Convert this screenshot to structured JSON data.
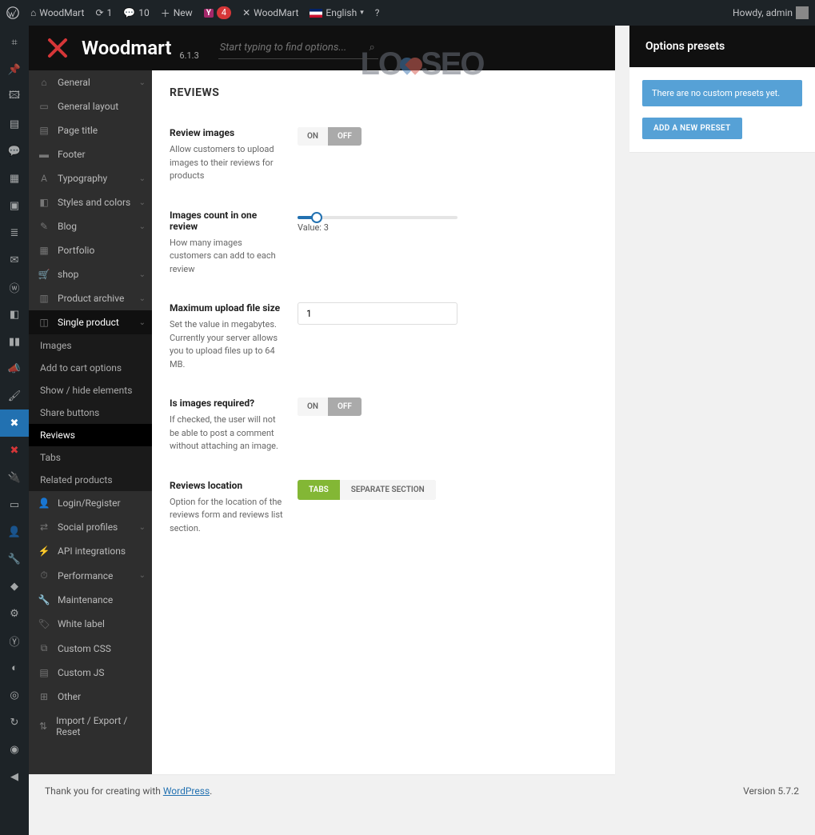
{
  "wp_bar": {
    "site": "WoodMart",
    "updates": "1",
    "comments": "10",
    "new": "New",
    "yoast_badge": "4",
    "theme_link": "WoodMart",
    "lang": "English",
    "howdy": "Howdy, admin"
  },
  "header": {
    "brand": "Woodmart",
    "version": "6.1.3",
    "search_placeholder": "Start typing to find options..."
  },
  "nav": {
    "items": [
      {
        "label": "General",
        "icon": "home",
        "chev": true
      },
      {
        "label": "General layout",
        "icon": "layout"
      },
      {
        "label": "Page title",
        "icon": "title"
      },
      {
        "label": "Footer",
        "icon": "footer"
      },
      {
        "label": "Typography",
        "icon": "type",
        "chev": true
      },
      {
        "label": "Styles and colors",
        "icon": "palette",
        "chev": true
      },
      {
        "label": "Blog",
        "icon": "blog",
        "chev": true
      },
      {
        "label": "Portfolio",
        "icon": "grid"
      },
      {
        "label": "shop",
        "icon": "cart",
        "chev": true
      },
      {
        "label": "Product archive",
        "icon": "archive",
        "chev": true
      },
      {
        "label": "Single product",
        "icon": "product",
        "chev": true,
        "active": true
      },
      {
        "label": "Login/Register",
        "icon": "user"
      },
      {
        "label": "Social profiles",
        "icon": "share",
        "chev": true
      },
      {
        "label": "API integrations",
        "icon": "api"
      },
      {
        "label": "Performance",
        "icon": "perf",
        "chev": true
      },
      {
        "label": "Maintenance",
        "icon": "wrench"
      },
      {
        "label": "White label",
        "icon": "tag"
      },
      {
        "label": "Custom CSS",
        "icon": "css"
      },
      {
        "label": "Custom JS",
        "icon": "js"
      },
      {
        "label": "Other",
        "icon": "other"
      },
      {
        "label": "Import / Export / Reset",
        "icon": "import"
      }
    ],
    "sub": [
      {
        "label": "Images"
      },
      {
        "label": "Add to cart options"
      },
      {
        "label": "Show / hide elements"
      },
      {
        "label": "Share buttons"
      },
      {
        "label": "Reviews",
        "active": true
      },
      {
        "label": "Tabs"
      },
      {
        "label": "Related products"
      }
    ]
  },
  "settings": {
    "title": "REVIEWS",
    "rows": {
      "review_images": {
        "label": "Review images",
        "desc": "Allow customers to upload images to their reviews for products",
        "on": "ON",
        "off": "OFF",
        "value": "ON"
      },
      "images_count": {
        "label": "Images count in one review",
        "desc": "How many images customers can add to each review",
        "value_label": "Value:",
        "value": "3",
        "fill_pct": 12
      },
      "max_upload": {
        "label": "Maximum upload file size",
        "desc": "Set the value in megabytes. Currently your server allows you to upload files up to 64 MB.",
        "value": "1"
      },
      "required": {
        "label": "Is images required?",
        "desc": "If checked, the user will not be able to post a comment without attaching an image.",
        "on": "ON",
        "off": "OFF",
        "value": "OFF"
      },
      "location": {
        "label": "Reviews location",
        "desc": "Option for the location of the reviews form and reviews list section.",
        "opt1": "TABS",
        "opt2": "SEPARATE SECTION",
        "value": "TABS"
      }
    }
  },
  "presets": {
    "title": "Options presets",
    "empty": "There are no custom presets yet.",
    "add": "ADD A NEW PRESET"
  },
  "footer": {
    "thanks_pre": "Thank you for creating with ",
    "thanks_link": "WordPress",
    "thanks_post": ".",
    "version": "Version 5.7.2"
  },
  "watermark": {
    "l1": "LO",
    "l2": "SEO"
  }
}
